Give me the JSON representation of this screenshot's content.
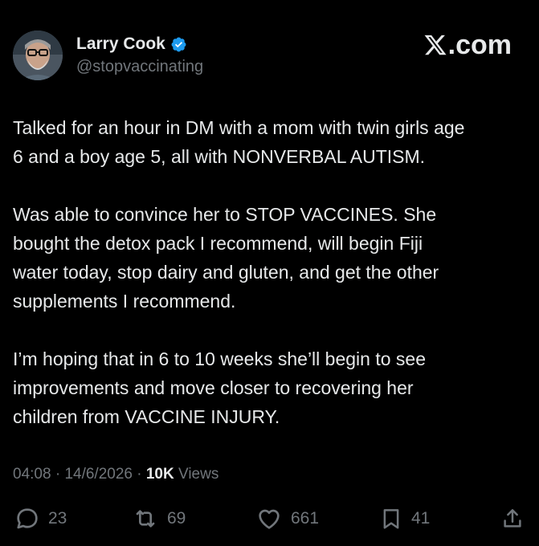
{
  "brand": {
    "text": ".com",
    "logo_icon": "x-logo-icon"
  },
  "author": {
    "name": "Larry Cook",
    "handle": "@stopvaccinating",
    "verified_color": "#1d9bf0",
    "avatar_icon": "avatar-photo"
  },
  "tweet": {
    "paragraphs": [
      "Talked for an hour in DM with a mom with twin girls age\n6 and a boy age 5, all with NONVERBAL AUTISM.",
      "Was able to convince her to STOP VACCINES. She\nbought the detox pack I recommend, will begin Fiji\nwater today, stop dairy and gluten, and get the other\nsupplements I recommend.",
      "I’m hoping that in 6 to 10 weeks she’ll begin to see\nimprovements and move closer to recovering her\nchildren from VACCINE INJURY."
    ]
  },
  "meta": {
    "time": "04:08",
    "sep1": "·",
    "date": "14/6/2026",
    "sep2": "·",
    "views_count": "10K",
    "views_label": "Views"
  },
  "actions": {
    "reply_count": "23",
    "repost_count": "69",
    "like_count": "661",
    "bookmark_count": "41"
  },
  "colors": {
    "background": "#000000",
    "text": "#e7e9ea",
    "muted": "#71767b",
    "verified": "#1d9bf0"
  }
}
